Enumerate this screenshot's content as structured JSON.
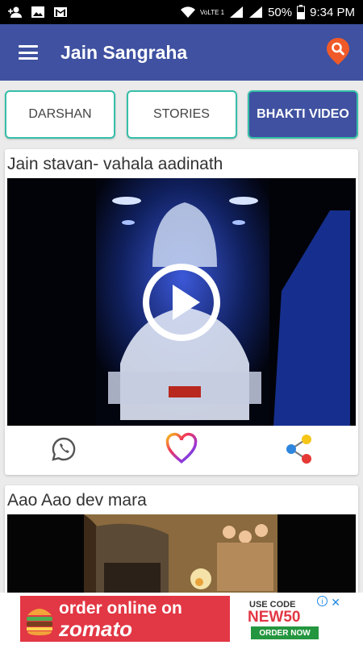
{
  "status_bar": {
    "battery": "50%",
    "time": "9:34 PM",
    "network_label": "VoLTE 1"
  },
  "app_bar": {
    "title": "Jain Sangraha",
    "menu_icon": "hamburger-menu-icon",
    "search_icon": "search-icon"
  },
  "tabs": [
    {
      "label": "DARSHAN",
      "active": false
    },
    {
      "label": "STORIES",
      "active": false
    },
    {
      "label": "BHAKTI VIDEO",
      "active": true
    }
  ],
  "videos": [
    {
      "title": "Jain stavan- vahala aadinath",
      "actions": [
        "whatsapp-icon",
        "heart-icon",
        "share-icon"
      ]
    },
    {
      "title": "Aao Aao dev mara"
    }
  ],
  "ad": {
    "line1": "order online on",
    "line2": "zomato",
    "use_code_label": "USE CODE",
    "code": "NEW50",
    "cta": "ORDER NOW",
    "close": "✕",
    "info": "i"
  },
  "colors": {
    "primary": "#3f51a0",
    "tab_border": "#35bfa8",
    "search_bubble": "#f05a28",
    "ad_red": "#e23744",
    "ad_green": "#24963f"
  }
}
